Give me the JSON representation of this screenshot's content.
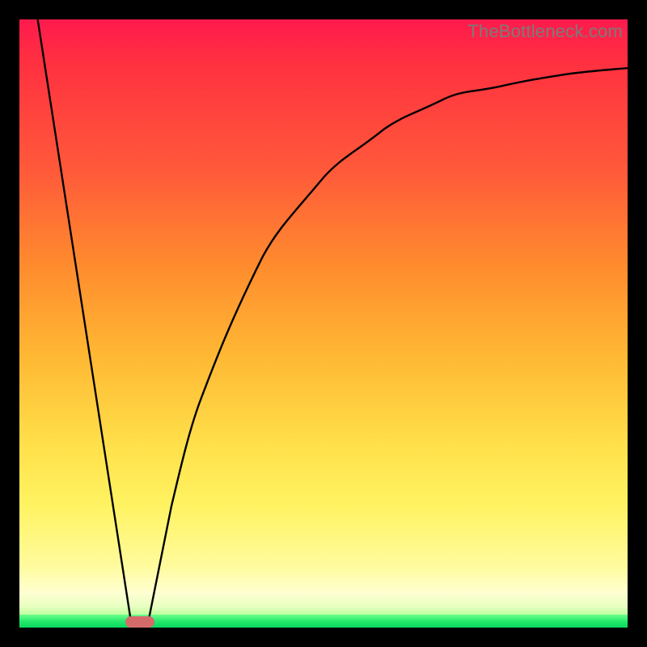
{
  "watermark": "TheBottleneck.com",
  "chart_data": {
    "type": "line",
    "title": "",
    "xlabel": "",
    "ylabel": "",
    "xlim": [
      0,
      100
    ],
    "ylim": [
      0,
      100
    ],
    "grid": false,
    "legend": false,
    "background_gradient": {
      "stops": [
        {
          "pos": 0.0,
          "color": "#ff1a4d"
        },
        {
          "pos": 0.25,
          "color": "#ff5a3a"
        },
        {
          "pos": 0.55,
          "color": "#ffb733"
        },
        {
          "pos": 0.8,
          "color": "#fff362"
        },
        {
          "pos": 0.95,
          "color": "#ffffd4"
        },
        {
          "pos": 0.98,
          "color": "#6cff8a"
        },
        {
          "pos": 1.0,
          "color": "#08d85e"
        }
      ]
    },
    "series": [
      {
        "name": "left-branch",
        "x": [
          3,
          18.5
        ],
        "y": [
          100,
          0
        ]
      },
      {
        "name": "right-branch",
        "x": [
          21,
          25,
          30,
          35,
          40,
          45,
          50,
          55,
          60,
          65,
          70,
          75,
          80,
          85,
          90,
          95,
          100
        ],
        "y": [
          0,
          20,
          38,
          51,
          61,
          68,
          74,
          78,
          82,
          84.5,
          86.5,
          88,
          89.2,
          90.2,
          91,
          91.6,
          92
        ]
      }
    ],
    "marker": {
      "name": "optimal-point",
      "x_center": 20,
      "y": 0,
      "width_pct": 4.8,
      "height_pct": 1.9,
      "color": "#d46a6a"
    }
  },
  "colors": {
    "frame": "#000000",
    "curve": "#000000",
    "marker": "#d46a6a",
    "watermark": "#7b7b7b"
  }
}
